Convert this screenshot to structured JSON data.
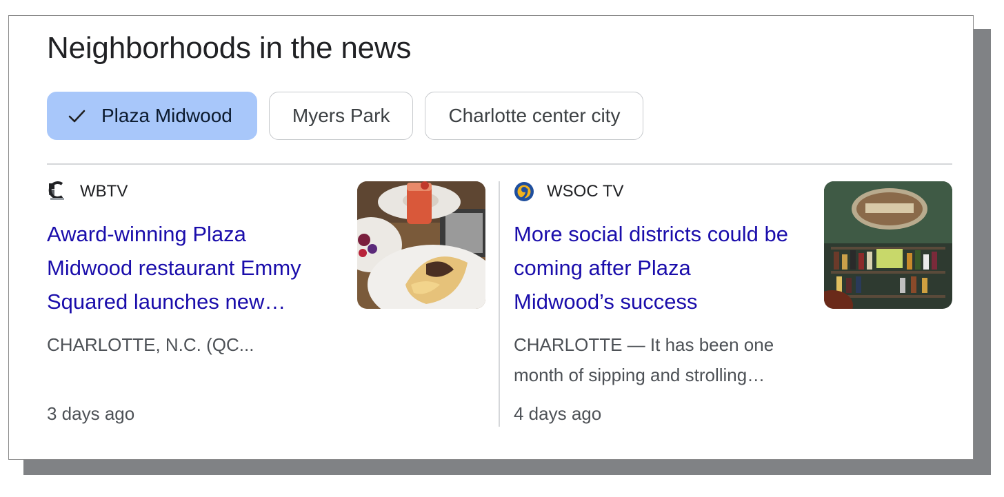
{
  "section": {
    "title": "Neighborhoods in the news"
  },
  "chips": [
    {
      "label": "Plaza Midwood",
      "selected": true,
      "icon": "check-icon"
    },
    {
      "label": "Myers Park",
      "selected": false
    },
    {
      "label": "Charlotte center city",
      "selected": false
    }
  ],
  "articles": [
    {
      "source": "WBTV",
      "source_icon": "wbtv-logo-icon",
      "headline": "Award-winning Plaza Midwood restaurant Emmy Squared launches new…",
      "snippet": "CHARLOTTE, N.C. (QC...",
      "time": "3 days ago",
      "thumbnail": "food-plates-thumbnail"
    },
    {
      "source": "WSOC TV",
      "source_icon": "wsoc-logo-icon",
      "headline": "More social districts could be coming after Plaza Midwood’s success",
      "snippet": "CHARLOTTE — It has been one month of sipping and strolling…",
      "time": "4 days ago",
      "thumbnail": "bar-shelves-thumbnail"
    }
  ],
  "colors": {
    "link": "#1a0dab",
    "chip_selected_bg": "#a8c7fa",
    "shadow": "#808285"
  }
}
